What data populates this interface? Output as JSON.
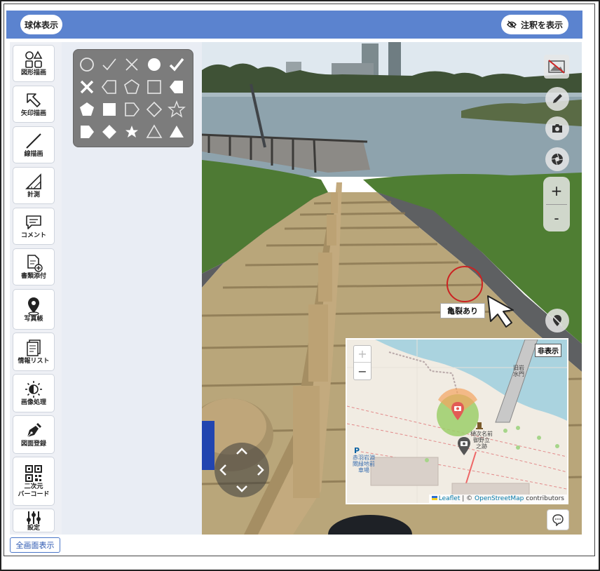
{
  "topbar": {
    "sphere_label": "球体表示",
    "annotation_label": "注釈を表示",
    "color": "#5b83cf"
  },
  "sidebar": {
    "items": [
      {
        "label": "図形描画",
        "icon": "shapes-icon"
      },
      {
        "label": "矢印描画",
        "icon": "arrow-icon"
      },
      {
        "label": "線描画",
        "icon": "line-icon"
      },
      {
        "label": "計測",
        "icon": "ruler-triangle-icon"
      },
      {
        "label": "コメント",
        "icon": "comment-icon"
      },
      {
        "label": "書類添付",
        "icon": "document-attach-icon"
      },
      {
        "label": "写真帳",
        "icon": "map-pin-icon"
      },
      {
        "label": "情報リスト",
        "icon": "list-icon"
      },
      {
        "label": "画像処理",
        "icon": "brightness-icon"
      },
      {
        "label": "図面登録",
        "icon": "pen-nib-icon"
      },
      {
        "label": "二次元\nバーコード",
        "icon": "qr-code-icon"
      },
      {
        "label": "設定",
        "icon": "sliders-icon"
      }
    ]
  },
  "shape_palette": {
    "shapes": [
      "circle-outline",
      "check-outline",
      "cross-outline",
      "circle-filled",
      "check-filled",
      "cross-filled",
      "pentagon-arrow-left-outline",
      "pentagon-outline",
      "square-outline",
      "pentagon-arrow-left-filled",
      "pentagon-filled",
      "square-filled",
      "pentagon-arrow-right-outline",
      "diamond-outline",
      "star-outline",
      "pentagon-arrow-right-filled",
      "diamond-filled",
      "star-filled",
      "triangle-outline",
      "triangle-filled"
    ]
  },
  "panorama": {
    "annotation_label": "亀裂あり",
    "annotation_color": "#cc2222"
  },
  "minimap": {
    "hide_label": "非表示",
    "zoom_in": "+",
    "zoom_out": "−",
    "attribution_leaflet": "Leaflet",
    "attribution_sep": " | © ",
    "attribution_osm": "OpenStreetMap",
    "attribution_tail": " contributors",
    "label_old_iwabuchi": "旧岩\n水門",
    "label_monument": "樋次名前\n御野立\n之跡",
    "label_station": "赤羽岩淵\n閘緑地前\n車場",
    "parking_symbol": "P"
  },
  "zoom_controls": {
    "plus": "+",
    "minus": "-"
  },
  "footer": {
    "fullscreen_label": "全画面表示"
  }
}
